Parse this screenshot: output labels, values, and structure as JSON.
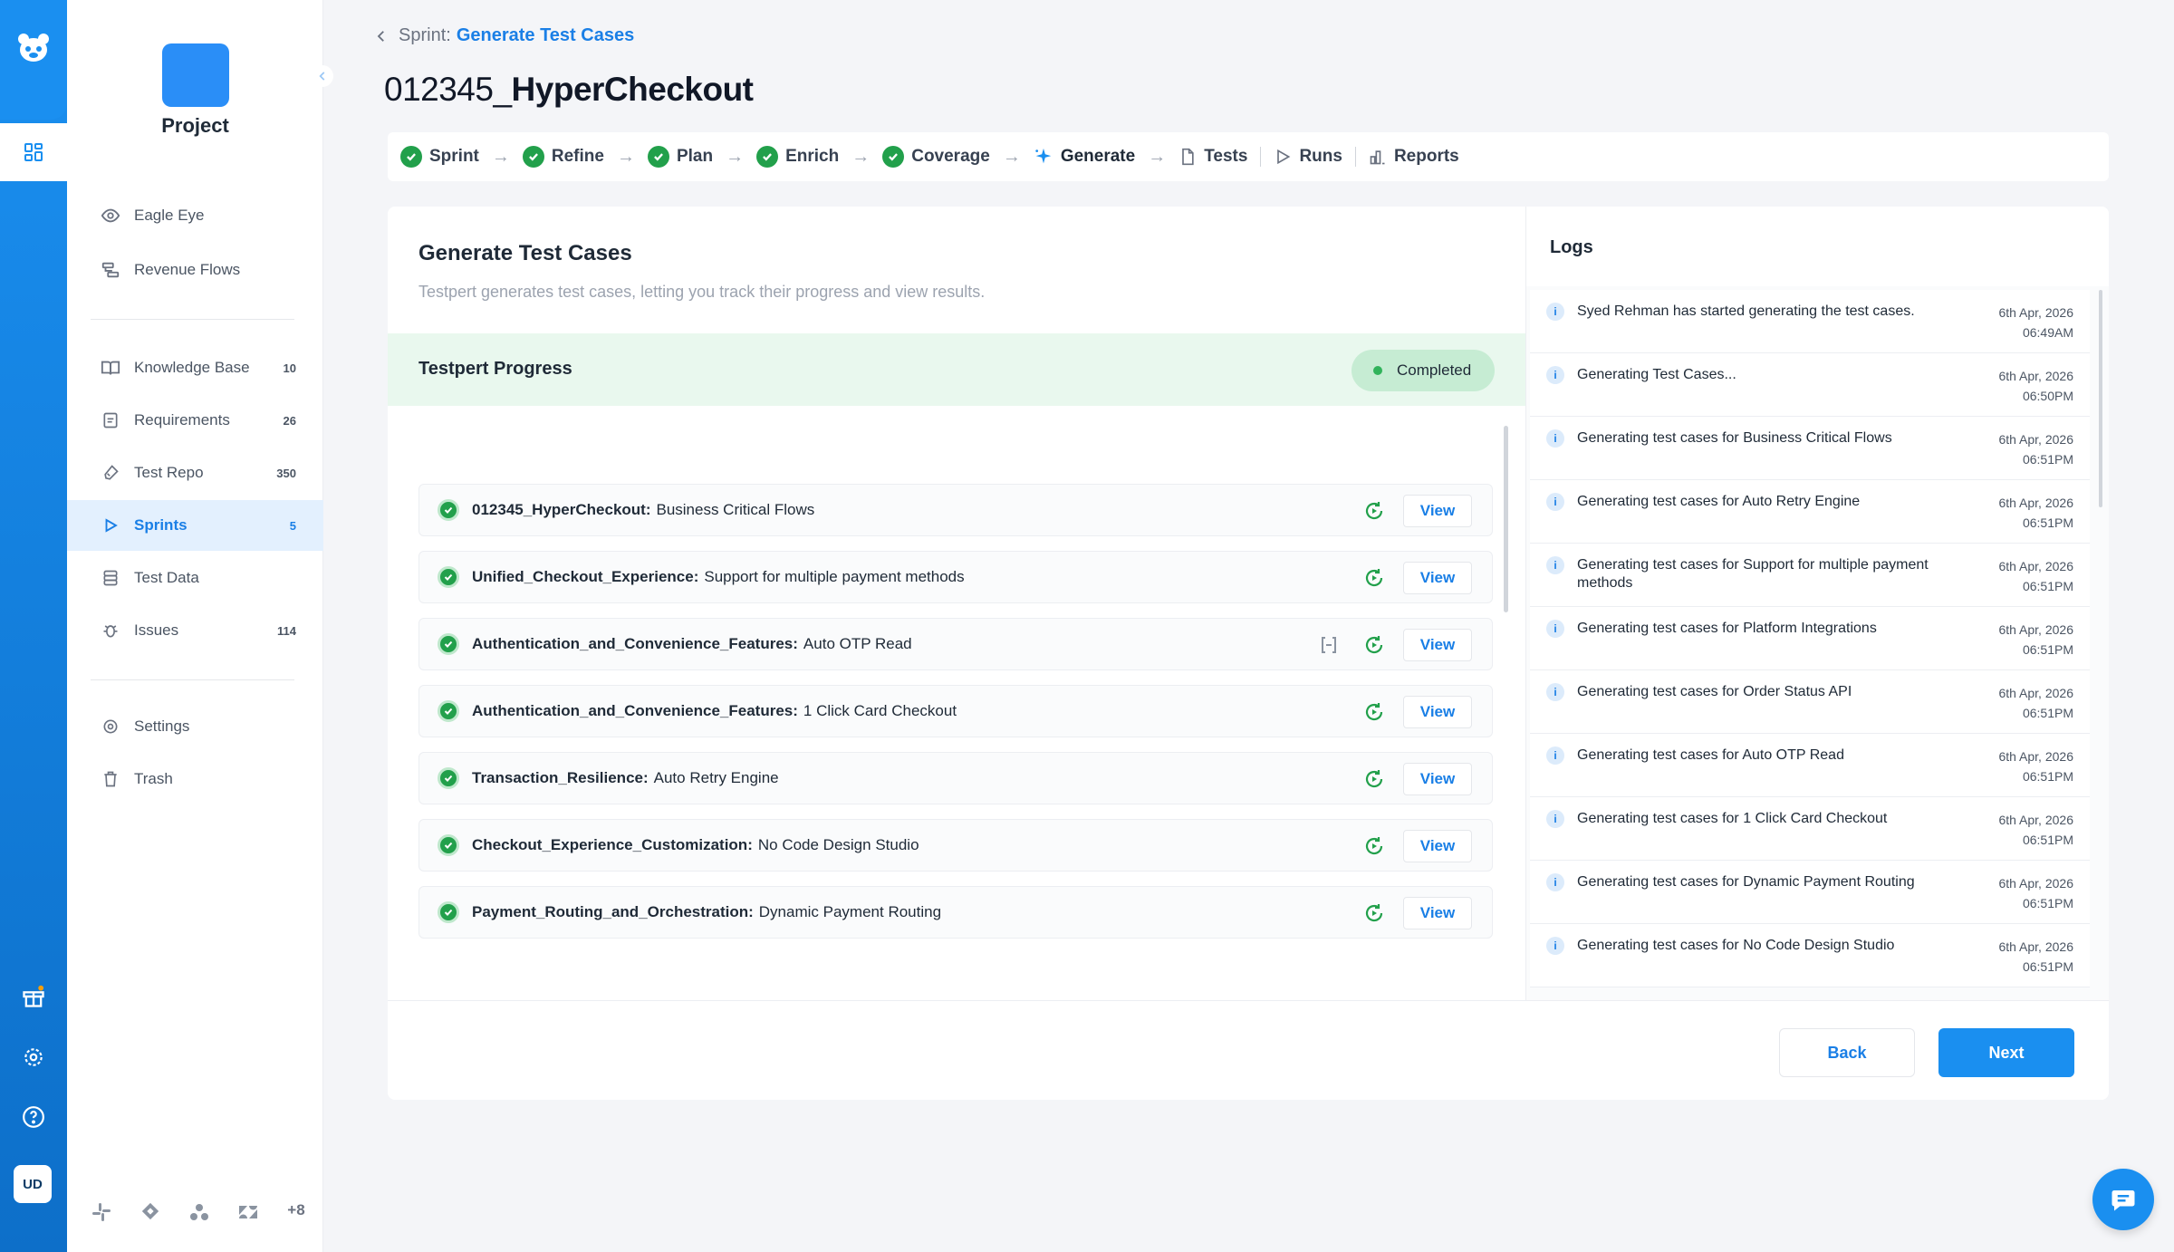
{
  "sidebar": {
    "project_name": "Project",
    "items": [
      {
        "label": "Eagle Eye",
        "count": ""
      },
      {
        "label": "Revenue Flows",
        "count": ""
      },
      {
        "label": "Knowledge Base",
        "count": "10"
      },
      {
        "label": "Requirements",
        "count": "26"
      },
      {
        "label": "Test Repo",
        "count": "350"
      },
      {
        "label": "Sprints",
        "count": "5"
      },
      {
        "label": "Test Data",
        "count": ""
      },
      {
        "label": "Issues",
        "count": "114"
      },
      {
        "label": "Settings",
        "count": ""
      },
      {
        "label": "Trash",
        "count": ""
      }
    ],
    "integrations_more": "+8"
  },
  "rail": {
    "avatar": "UD"
  },
  "breadcrumb": {
    "prefix": "Sprint:",
    "current": "Generate Test Cases"
  },
  "page": {
    "title_prefix": "012345_",
    "title_main": "HyperCheckout"
  },
  "stepper": {
    "steps": [
      "Sprint",
      "Refine",
      "Plan",
      "Enrich",
      "Coverage",
      "Generate",
      "Tests",
      "Runs",
      "Reports"
    ]
  },
  "panel": {
    "title": "Generate Test Cases",
    "subtitle": "Testpert generates test cases, letting you track their progress and view results.",
    "progress_title": "Testpert Progress",
    "status": "Completed",
    "view_label": "View",
    "tasks": [
      {
        "key": "012345_HyperCheckout:",
        "name": "Business Critical Flows"
      },
      {
        "key": "Unified_Checkout_Experience:",
        "name": "Support for multiple payment methods"
      },
      {
        "key": "Authentication_and_Convenience_Features:",
        "name": "Auto OTP Read"
      },
      {
        "key": "Authentication_and_Convenience_Features:",
        "name": "1 Click Card Checkout"
      },
      {
        "key": "Transaction_Resilience:",
        "name": "Auto Retry Engine"
      },
      {
        "key": "Checkout_Experience_Customization:",
        "name": "No Code Design Studio"
      },
      {
        "key": "Payment_Routing_and_Orchestration:",
        "name": "Dynamic Payment Routing"
      }
    ]
  },
  "logs": {
    "title": "Logs",
    "entries": [
      {
        "msg": "Syed Rehman has started generating the test cases.",
        "date": "6th Apr, 2026",
        "time": "06:49AM"
      },
      {
        "msg": "Generating Test Cases...",
        "date": "6th Apr, 2026",
        "time": "06:50PM"
      },
      {
        "msg": "Generating test cases for Business Critical Flows",
        "date": "6th Apr, 2026",
        "time": "06:51PM"
      },
      {
        "msg": "Generating test cases for Auto Retry Engine",
        "date": "6th Apr, 2026",
        "time": "06:51PM"
      },
      {
        "msg": "Generating test cases for Support for multiple payment methods",
        "date": "6th Apr, 2026",
        "time": "06:51PM"
      },
      {
        "msg": "Generating test cases for Platform Integrations",
        "date": "6th Apr, 2026",
        "time": "06:51PM"
      },
      {
        "msg": "Generating test cases for Order Status API",
        "date": "6th Apr, 2026",
        "time": "06:51PM"
      },
      {
        "msg": "Generating test cases for Auto OTP Read",
        "date": "6th Apr, 2026",
        "time": "06:51PM"
      },
      {
        "msg": "Generating test cases for 1 Click Card Checkout",
        "date": "6th Apr, 2026",
        "time": "06:51PM"
      },
      {
        "msg": "Generating test cases for Dynamic Payment Routing",
        "date": "6th Apr, 2026",
        "time": "06:51PM"
      },
      {
        "msg": "Generating test cases for No Code Design Studio",
        "date": "6th Apr, 2026",
        "time": "06:51PM"
      }
    ]
  },
  "footer": {
    "back": "Back",
    "next": "Next"
  },
  "colors": {
    "accent": "#1a8ff0",
    "success": "#22a04b",
    "success_bg": "#e9f8ee"
  }
}
